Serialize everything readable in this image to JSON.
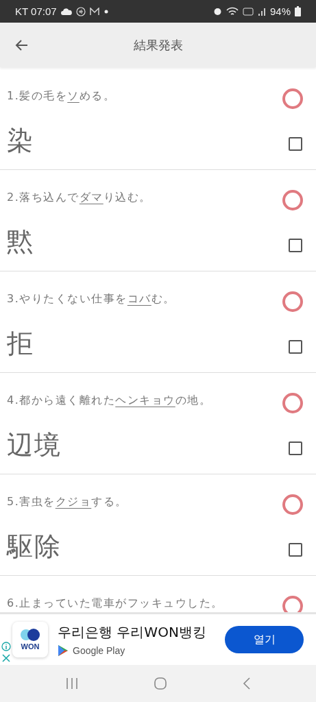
{
  "status_bar": {
    "carrier_time": "KT 07:07",
    "battery": "94%"
  },
  "app_bar": {
    "title": "結果発表"
  },
  "items": [
    {
      "prefix": "1.髪の毛を",
      "target": "ソ",
      "suffix": "める。",
      "answer": "染",
      "correct": true,
      "checked": false
    },
    {
      "prefix": "2.落ち込んで",
      "target": "ダマ",
      "suffix": "り込む。",
      "answer": "黙",
      "correct": true,
      "checked": false
    },
    {
      "prefix": "3.やりたくない仕事を",
      "target": "コバ",
      "suffix": "む。",
      "answer": "拒",
      "correct": true,
      "checked": false
    },
    {
      "prefix": "4.都から遠く離れた",
      "target": "ヘンキョウ",
      "suffix": "の地。",
      "answer": "辺境",
      "correct": true,
      "checked": false
    },
    {
      "prefix": "5.害虫を",
      "target": "クジョ",
      "suffix": "する。",
      "answer": "駆除",
      "correct": true,
      "checked": false
    },
    {
      "prefix": "6.止まっていた電車がフッキュウした。",
      "correct": true
    }
  ],
  "ad": {
    "logo_text": "WON",
    "title": "우리은행 우리WON뱅킹",
    "store": "Google Play",
    "button": "열기"
  }
}
